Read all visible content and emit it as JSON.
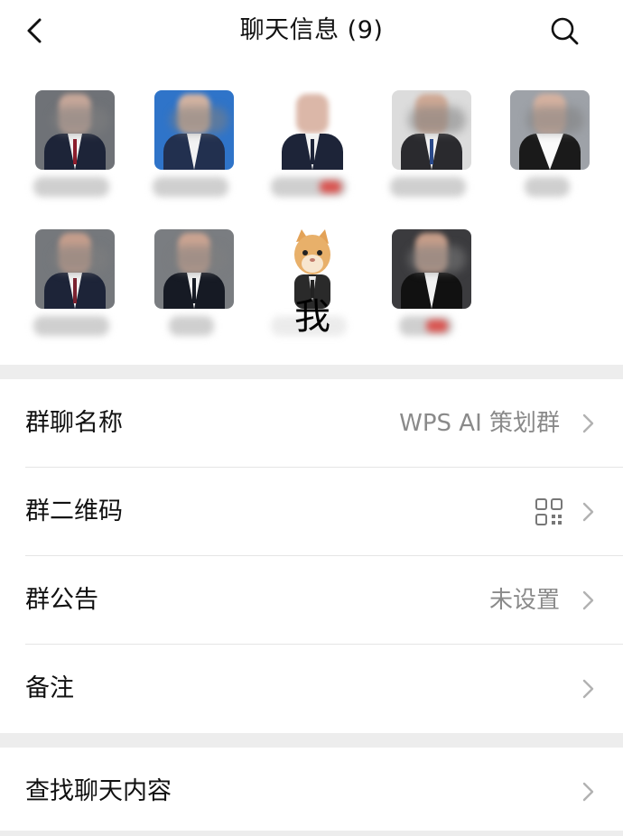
{
  "header": {
    "title": "聊天信息 (9)",
    "back_icon": "chevron-left-icon",
    "search_icon": "search-icon"
  },
  "members": {
    "self_label": "我",
    "count": 9
  },
  "settings": {
    "group_name_label": "群聊名称",
    "group_name_value": "WPS AI 策划群",
    "qr_label": "群二维码",
    "announcement_label": "群公告",
    "announcement_value": "未设置",
    "remark_label": "备注"
  },
  "search_section": {
    "find_content_label": "查找聊天内容"
  },
  "colors": {
    "background": "#ededed",
    "card": "#ffffff",
    "secondary_text": "#8a8a8a",
    "chevron": "#b2b2b2"
  }
}
